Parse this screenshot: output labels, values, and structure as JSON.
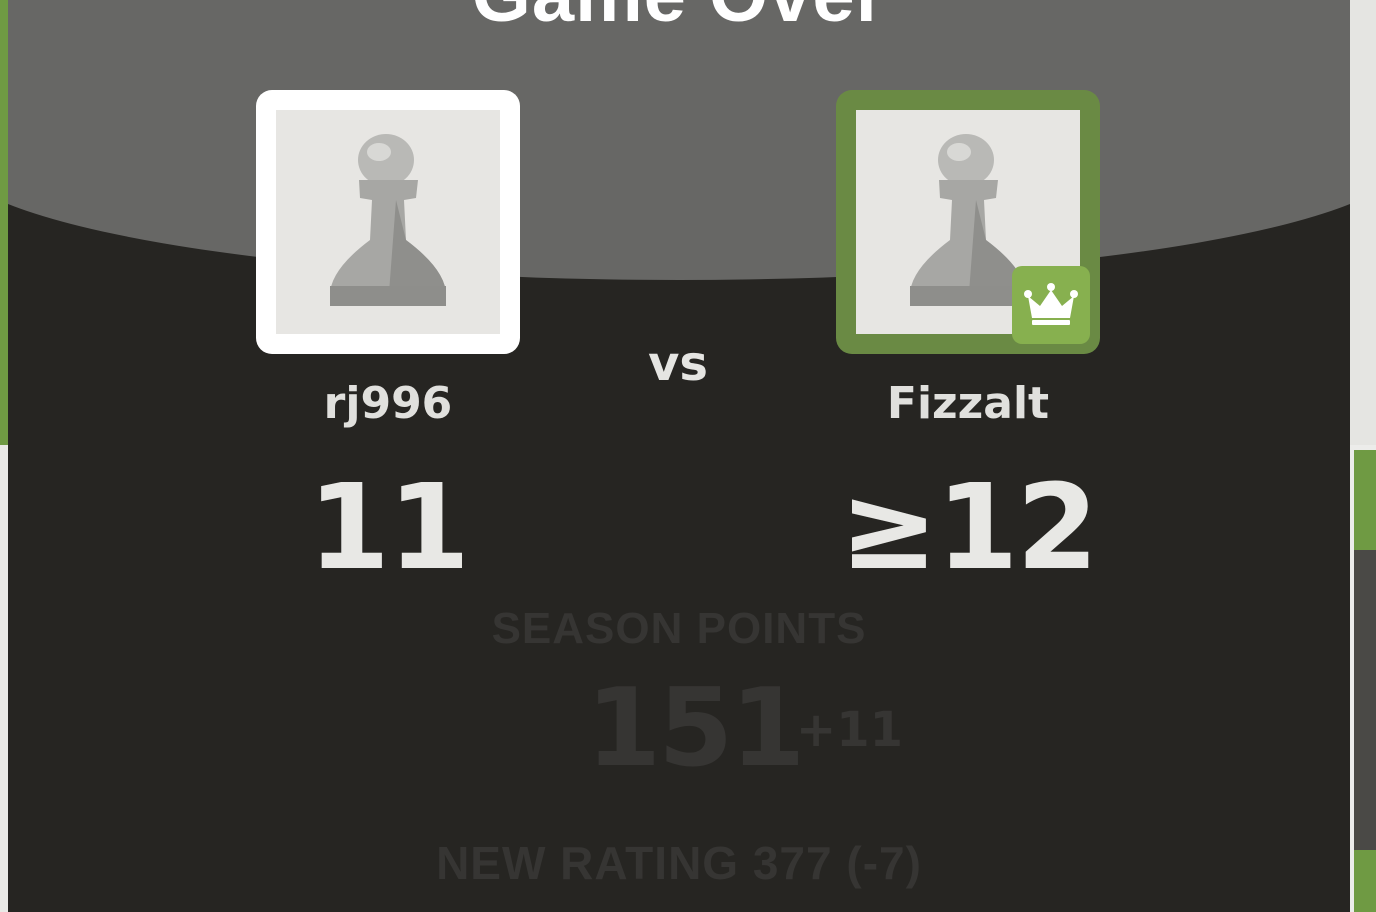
{
  "title": "Game Over",
  "vs_label": "vs",
  "player_left": {
    "name": "rj996",
    "score": "11",
    "avatar_icon": "pawn-icon"
  },
  "player_right": {
    "name": "Fizzalt",
    "score": "≥12",
    "avatar_icon": "pawn-icon",
    "badge_icon": "crown-icon"
  },
  "season": {
    "label": "SEASON POINTS",
    "value": "151",
    "delta": "+11"
  },
  "rating": {
    "text": "NEW RATING 377 (-7)"
  },
  "colors": {
    "accent_green": "#87b04f",
    "avatar_border_green": "#6a8a44",
    "panel_dark": "#262522",
    "header_gray": "#676765"
  }
}
